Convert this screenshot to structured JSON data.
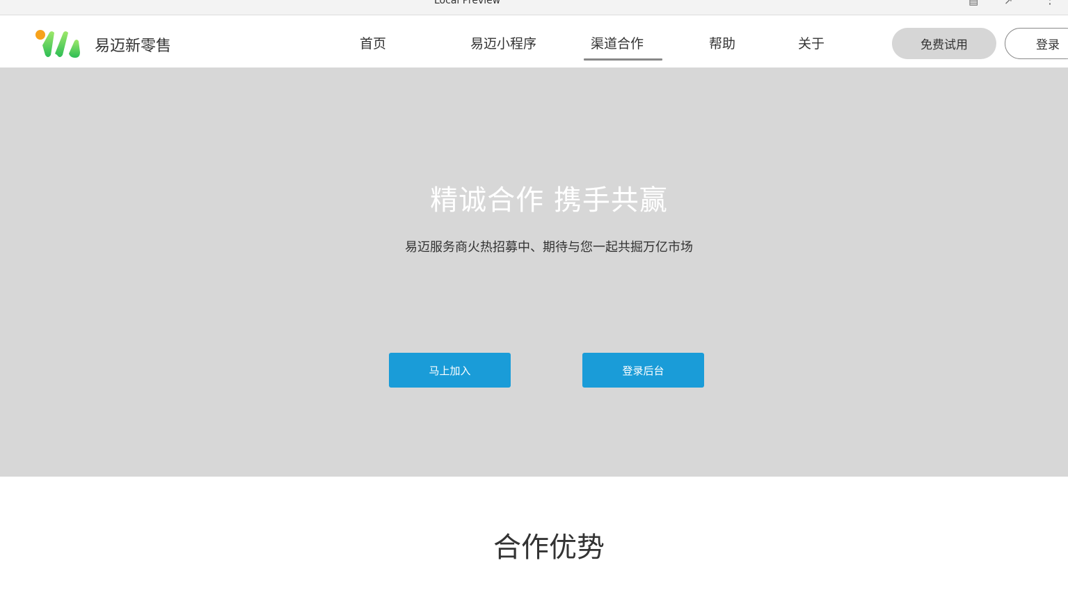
{
  "preview": {
    "title": "Local Preview",
    "icons": [
      "document-icon",
      "export-icon",
      "more-icon"
    ]
  },
  "header": {
    "brand": "易迈新零售",
    "nav": [
      {
        "label": "首页",
        "active": false
      },
      {
        "label": "易迈小程序",
        "active": false
      },
      {
        "label": "渠道合作",
        "active": true
      },
      {
        "label": "帮助",
        "active": false
      },
      {
        "label": "关于",
        "active": false
      }
    ],
    "trial_label": "免费试用",
    "login_label": "登录"
  },
  "hero": {
    "title": "精诚合作 携手共赢",
    "subtitle": "易迈服务商火热招募中、期待与您一起共掘万亿市场",
    "join_label": "马上加入",
    "backend_label": "登录后台"
  },
  "section": {
    "title": "合作优势"
  },
  "colors": {
    "accent_blue": "#1a9cd8",
    "hero_bg": "#d7d7d7",
    "logo_green": "#3ec654",
    "logo_orange": "#f7a21b"
  }
}
